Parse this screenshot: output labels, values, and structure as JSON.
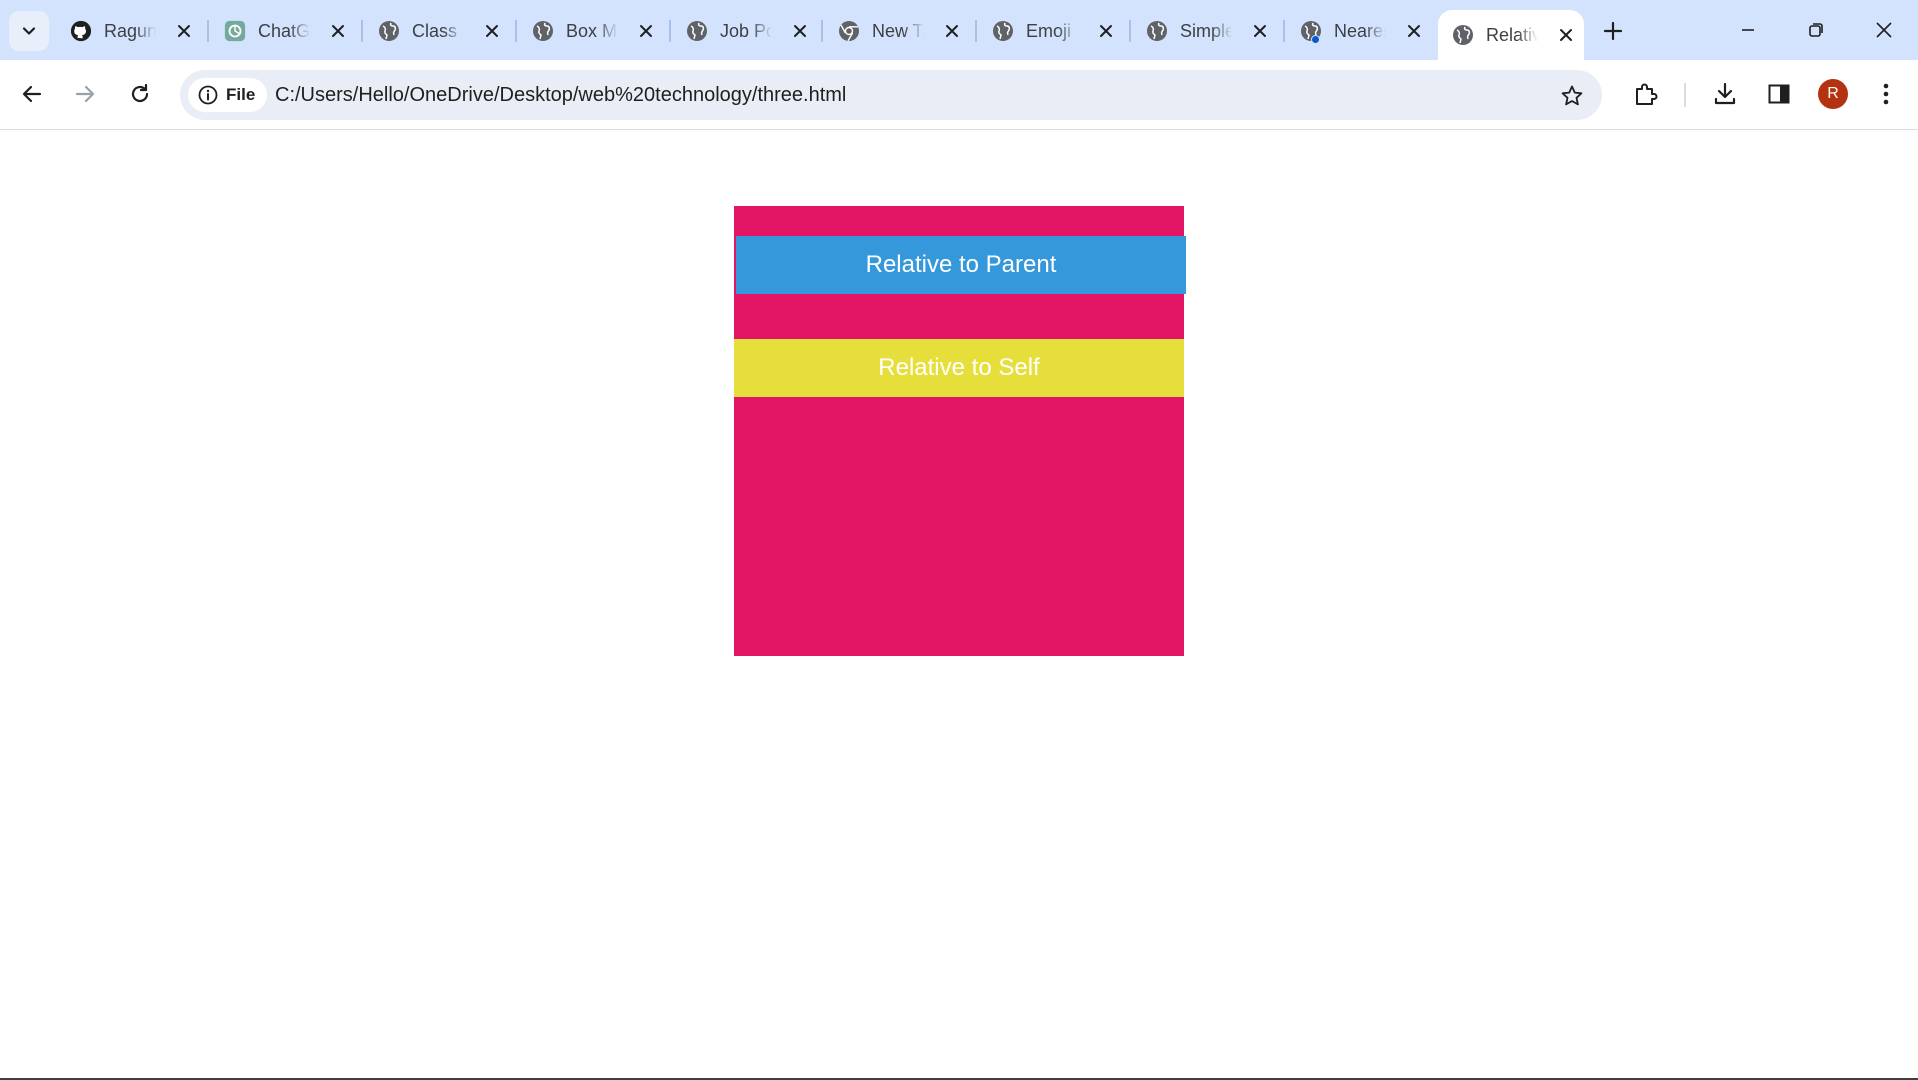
{
  "browser": {
    "tabs": [
      {
        "title": "Ragunath",
        "icon": "github-icon",
        "active": false
      },
      {
        "title": "ChatGPT",
        "icon": "chatgpt-icon",
        "active": false
      },
      {
        "title": "Class",
        "icon": "globe-icon",
        "active": false
      },
      {
        "title": "Box Model",
        "icon": "globe-icon",
        "active": false
      },
      {
        "title": "Job Portal",
        "icon": "globe-icon",
        "active": false
      },
      {
        "title": "New Tab",
        "icon": "chrome-icon",
        "active": false
      },
      {
        "title": "Emoji",
        "icon": "globe-icon",
        "active": false
      },
      {
        "title": "Simple",
        "icon": "globe-icon",
        "active": false
      },
      {
        "title": "Nearest",
        "icon": "globe-icon",
        "active": false
      },
      {
        "title": "Relative",
        "icon": "globe-icon",
        "active": true
      }
    ],
    "chip_label": "File",
    "url": "C:/Users/Hello/OneDrive/Desktop/web%20technology/three.html",
    "profile_initial": "R"
  },
  "page": {
    "parent_color": "#e31565",
    "boxes": {
      "relative_parent": {
        "label": "Relative to Parent",
        "color": "#3498db"
      },
      "relative_self": {
        "label": "Relative to Self",
        "color": "#e6df3b"
      }
    }
  },
  "colors": {
    "tabstrip_bg": "#d3e3fd",
    "omnibox_bg": "#e9eef6",
    "avatar_bg": "#b33310"
  }
}
